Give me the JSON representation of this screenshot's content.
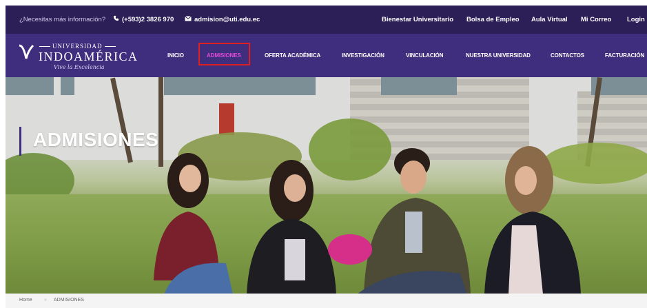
{
  "topbar": {
    "question": "¿Necesitas más información?",
    "phone": "(+593)2 3826 970",
    "email": "admision@uti.edu.ec",
    "links": [
      "Bienestar Universitario",
      "Bolsa de Empleo",
      "Aula Virtual",
      "Mi Correo",
      "Login"
    ]
  },
  "logo": {
    "top": "UNIVERSIDAD",
    "name": "INDOAMÉRICA",
    "tagline": "Vive la Excelencia"
  },
  "nav": {
    "items": [
      "INICIO",
      "ADMISIONES",
      "OFERTA ACADÉMICA",
      "INVESTIGACIÓN",
      "VINCULACIÓN",
      "NUESTRA UNIVERSIDAD",
      "CONTACTOS",
      "FACTURACIÓN"
    ],
    "active": "ADMISIONES"
  },
  "hero": {
    "title": "ADMISIONES"
  },
  "breadcrumb": {
    "home": "Home",
    "separator": "»",
    "current": "ADMISIONES"
  },
  "colors": {
    "topbar": "#2c1f58",
    "nav": "#3f2d7e",
    "active_nav": "#e04bd6",
    "highlight_box": "#e02020"
  },
  "icons": {
    "phone": "phone-icon",
    "email": "envelope-icon",
    "logo": "logo-emblem-icon"
  }
}
